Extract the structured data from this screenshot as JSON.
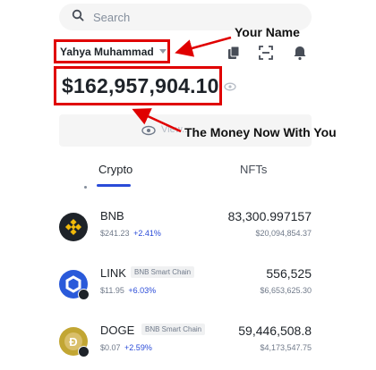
{
  "search": {
    "placeholder": "Search",
    "icon": "search-icon"
  },
  "account": {
    "name": "Yahya Muhammad",
    "caret_icon": "caret-down-icon"
  },
  "header_icons": [
    "clipboard-icon",
    "scan-icon",
    "bell-icon"
  ],
  "balance": {
    "amount": "$162,957,904.10",
    "eye_icon": "eye-icon"
  },
  "view_bar": {
    "label": "View..."
  },
  "annotations": {
    "name_label": "Your Name",
    "money_label": "The Money Now With You",
    "arrow_color": "#e00000"
  },
  "tabs": [
    {
      "label": "Crypto",
      "active": true
    },
    {
      "label": "NFTs",
      "active": false
    }
  ],
  "assets": [
    {
      "symbol": "BNB",
      "chain": "",
      "price": "$241.23",
      "change": "+2.41%",
      "amount": "83,300.997157",
      "value": "$20,094,854.37",
      "icon_color": "#1e2329",
      "icon_accent": "#f0b90b"
    },
    {
      "symbol": "LINK",
      "chain": "BNB Smart Chain",
      "price": "$11.95",
      "change": "+6.03%",
      "amount": "556,525",
      "value": "$6,653,625.30",
      "icon_color": "#2a5ada",
      "icon_accent": "#ffffff"
    },
    {
      "symbol": "DOGE",
      "chain": "BNB Smart Chain",
      "price": "$0.07",
      "change": "+2.59%",
      "amount": "59,446,508.8",
      "value": "$4,173,547.75",
      "icon_color": "#c2a633",
      "icon_accent": "#ffffff"
    }
  ]
}
